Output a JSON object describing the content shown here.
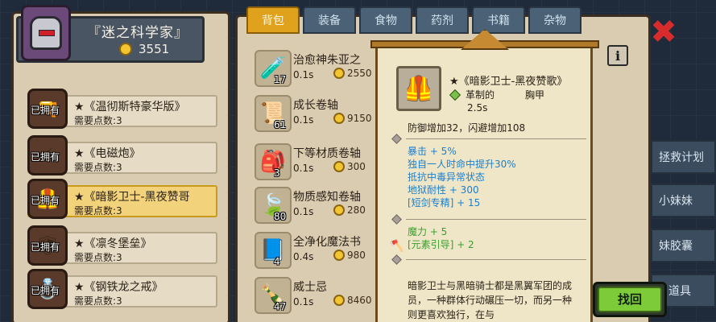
{
  "profile": {
    "title": "『迷之科学家』",
    "coins": "3551"
  },
  "left_list": [
    {
      "owned": "已拥有",
      "name": "★《温彻斯特豪华版》",
      "cost": "需要点数:3",
      "selected": false
    },
    {
      "owned": "已拥有",
      "name": "★《电磁炮》",
      "cost": "需要点数:3",
      "selected": false
    },
    {
      "owned": "已拥有",
      "name": "★《暗影卫士-黑夜赞哥",
      "cost": "需要点数:3",
      "selected": true
    },
    {
      "owned": "已拥有",
      "name": "★《凛冬堡垒》",
      "cost": "需要点数:3",
      "selected": false
    },
    {
      "owned": "已拥有",
      "name": "★《钢铁龙之戒》",
      "cost": "需要点数:3",
      "selected": false
    }
  ],
  "tabs": [
    "背包",
    "装备",
    "食物",
    "药剂",
    "书籍",
    "杂物"
  ],
  "inventory": [
    {
      "name": "治愈神朱亚之",
      "count": "17",
      "time": "0.1s",
      "price": "2550"
    },
    {
      "name": "成长卷轴",
      "count": "61",
      "time": "0.1s",
      "price": "9150"
    },
    {
      "name": "下等材质卷轴",
      "count": "3",
      "time": "0.1s",
      "price": "300"
    },
    {
      "name": "物质感知卷轴",
      "count": "80",
      "time": "0.1s",
      "price": "280"
    },
    {
      "name": "全净化魔法书",
      "count": "4",
      "time": "0.4s",
      "price": "980"
    },
    {
      "name": "威士忌",
      "count": "47",
      "time": "0.1s",
      "price": "8460"
    }
  ],
  "side_buttons": [
    "拯救计划",
    "小妹妹",
    "妹胶囊",
    "道具"
  ],
  "back_label": "找回",
  "popup": {
    "title": "★《暗影卫士-黑夜赞歌》",
    "material": "革制的",
    "slot": "胸甲",
    "time": "2.5s",
    "base": "防御增加32，闪避增加108",
    "stats": [
      "暴击 + 5%",
      "独自一人时命中提升30%",
      "抵抗中毒异常状态",
      "地狱耐性 + 300",
      "[短剑专精] + 15"
    ],
    "magic": [
      "魔力 + 5",
      "[元素引导] + 2"
    ],
    "lore": "暗影卫士与黑暗骑士都是黑翼军团的成员，一种群体行动碾压一切，而另一种则更喜欢独行，在与"
  },
  "info_label": "i"
}
